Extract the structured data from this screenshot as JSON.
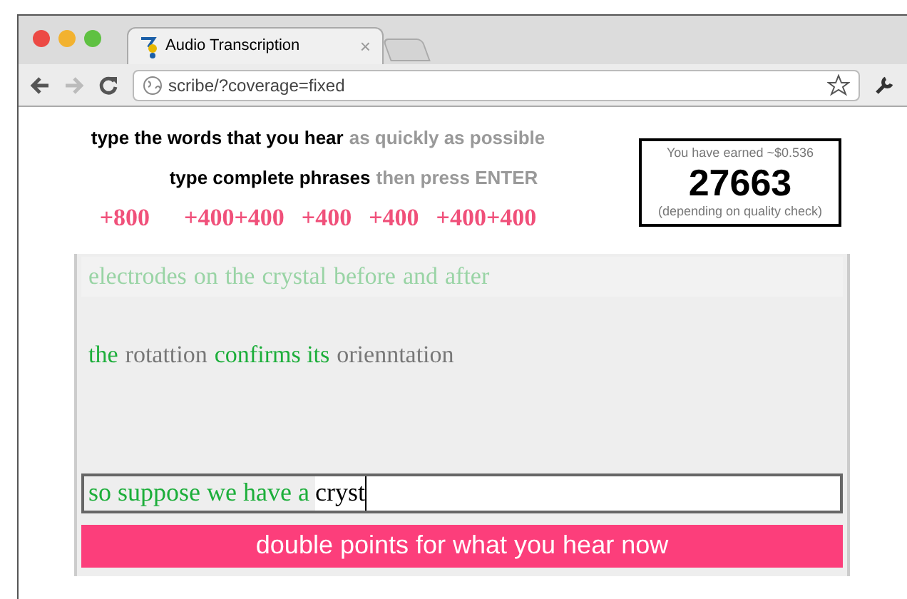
{
  "tab": {
    "title": "Audio Transcription",
    "close": "×"
  },
  "address": "scribe/?coverage=fixed",
  "instructions": [
    {
      "main": "type the words that you hear",
      "hint": "as quickly as possible"
    },
    {
      "main": "type complete phrases",
      "hint": "then press ENTER"
    }
  ],
  "points": [
    "+800",
    "+400+400",
    "+400",
    "+400",
    "+400+400"
  ],
  "score": {
    "caption": "You have earned ~$0.536",
    "value": "27663",
    "note": "(depending on quality check)"
  },
  "lines": [
    {
      "faded": true,
      "words": [
        {
          "text": "electrodes",
          "matched": true
        },
        {
          "text": "on",
          "matched": true
        },
        {
          "text": "the",
          "matched": true
        },
        {
          "text": "crystal",
          "matched": true
        },
        {
          "text": "before",
          "matched": true
        },
        {
          "text": "and",
          "matched": true
        },
        {
          "text": "after",
          "matched": true
        }
      ]
    },
    {
      "faded": false,
      "words": [
        {
          "text": "the",
          "matched": true
        },
        {
          "text": "rotattion",
          "matched": false
        },
        {
          "text": "confirms its",
          "matched": true
        },
        {
          "text": "orienntation",
          "matched": false
        }
      ]
    }
  ],
  "input": {
    "prefix": "so suppose we have a",
    "value": "cryst"
  },
  "banner": "double points for what you hear now"
}
